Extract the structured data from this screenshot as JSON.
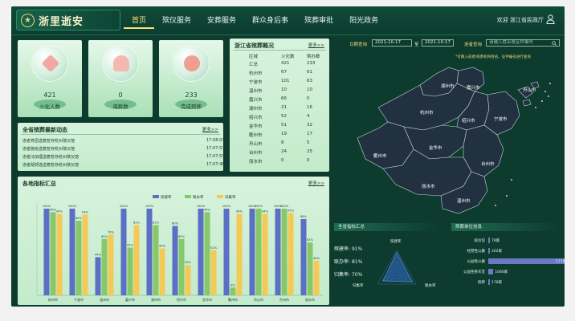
{
  "header": {
    "logo_text": "浙里逝安",
    "nav": [
      "首页",
      "殡仪服务",
      "安葬服务",
      "群众身后事",
      "殡葬审批",
      "阳光政务"
    ],
    "welcome": "欢迎 浙江省民政厅"
  },
  "stats": [
    {
      "value": "421",
      "label": "火化人数"
    },
    {
      "value": "0",
      "label": "海葬数"
    },
    {
      "value": "233",
      "label": "完成殡葬"
    }
  ],
  "news": {
    "title": "全省殡葬最新动态",
    "more": "更多>>",
    "rows": [
      {
        "text": "逝者育团送着暂存杭州殡仪馆",
        "time": "17:08:03"
      },
      {
        "text": "逝者施班送着暂存杭州殡仪馆",
        "time": "17:07:57"
      },
      {
        "text": "逝者冯加理送着暂存杭州殡仪馆",
        "time": "17:07:53"
      },
      {
        "text": "逝者胡郭连送着暂存杭州殡仪馆",
        "time": "17:07:48"
      }
    ]
  },
  "province_table": {
    "title": "浙江省殡葬概况",
    "more": "更多>>",
    "headers": [
      "区域",
      "火化数",
      "殡办数"
    ],
    "rows": [
      [
        "汇总",
        "421",
        "233"
      ],
      [
        "杭州市",
        "67",
        "61"
      ],
      [
        "宁波市",
        "101",
        "63"
      ],
      [
        "温州市",
        "10",
        "10"
      ],
      [
        "嘉兴市",
        "66",
        "0"
      ],
      [
        "湖州市",
        "21",
        "16"
      ],
      [
        "绍兴市",
        "52",
        "4"
      ],
      [
        "金华市",
        "51",
        "32"
      ],
      [
        "衢州市",
        "19",
        "17"
      ],
      [
        "舟山市",
        "8",
        "5"
      ],
      [
        "台州市",
        "24",
        "25"
      ],
      [
        "丽水市",
        "0",
        "0"
      ]
    ]
  },
  "filters": {
    "date_label": "日期查询",
    "date_from": "2021-10-17",
    "date_sep": "至",
    "date_to": "2021-10-17",
    "search_label": "逝者查询",
    "search_placeholder": "请输入姓名或证件编号",
    "note": "*可输入逝者/殡葬机构姓名、证件编号进行查询"
  },
  "map": {
    "cities": [
      "湖州市",
      "嘉兴市",
      "舟山市",
      "杭州市",
      "绍兴市",
      "宁波市",
      "金华市",
      "衢州市",
      "台州市",
      "丽水市",
      "温州市"
    ]
  },
  "chart_data": {
    "type": "bar",
    "title": "各地指标汇总",
    "more": "更多>>",
    "categories": [
      "杭州市",
      "宁波市",
      "温州市",
      "嘉兴市",
      "湖州市",
      "绍兴市",
      "金华市",
      "衢州市",
      "舟山市",
      "台州市",
      "丽水市"
    ],
    "series": [
      {
        "name": "殡建率",
        "values": [
          100,
          100,
          44,
          100,
          100,
          80,
          100,
          100,
          100,
          100,
          88
        ]
      },
      {
        "name": "联办率",
        "values": [
          96,
          86,
          65,
          55,
          81,
          65,
          96,
          9,
          100,
          100,
          61
        ]
      },
      {
        "name": "归集率",
        "values": [
          94,
          93,
          70,
          81,
          54,
          35,
          52,
          94,
          94,
          95,
          40
        ]
      }
    ],
    "ylim": [
      0,
      100
    ],
    "colors": [
      "#5b6fc4",
      "#86c86a",
      "#f4c958"
    ]
  },
  "indicators": {
    "title": "全省指标汇总",
    "items": [
      {
        "label": "殡建率:",
        "value": "91%"
      },
      {
        "label": "联办率:",
        "value": "81%"
      },
      {
        "label": "归集率:",
        "value": "70%"
      }
    ],
    "radar_labels": [
      "殡建率",
      "归集率",
      "联办率"
    ],
    "radar_values": [
      0.91,
      0.7,
      0.81
    ]
  },
  "units": {
    "title": "殡葬单位信息",
    "rows": [
      {
        "label": "殡仪馆",
        "value": "78家",
        "fraction": 0.004
      },
      {
        "label": "经营性公墓",
        "value": "202家",
        "fraction": 0.011
      },
      {
        "label": "公益性公墓",
        "value": "17791家",
        "fraction": 1.0
      },
      {
        "label": "公益性骨灰堂",
        "value": "1066家",
        "fraction": 0.06
      },
      {
        "label": "殡葬",
        "value": "178家",
        "fraction": 0.01
      }
    ]
  },
  "colors": {
    "bg": "#0d3b2e",
    "accent": "#f7e27a",
    "panel": "#d2f0d8",
    "map_fill": "#22313f"
  }
}
